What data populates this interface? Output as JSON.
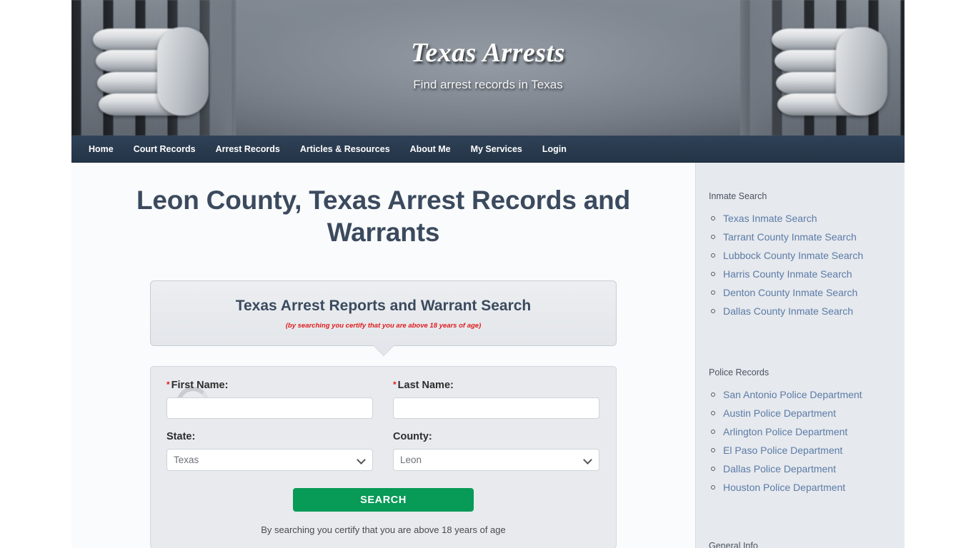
{
  "header": {
    "site_title": "Texas Arrests",
    "tagline": "Find arrest records in Texas"
  },
  "nav": {
    "items": [
      {
        "label": "Home"
      },
      {
        "label": "Court Records"
      },
      {
        "label": "Arrest Records"
      },
      {
        "label": "Articles & Resources"
      },
      {
        "label": "About Me"
      },
      {
        "label": "My Services"
      },
      {
        "label": "Login"
      }
    ]
  },
  "main": {
    "page_title": "Leon County, Texas Arrest Records and Warrants",
    "search_panel": {
      "heading": "Texas Arrest Reports and Warrant Search",
      "age_note": "(by searching you certify that you are above 18 years of age)"
    },
    "form": {
      "first_name": {
        "label": "First Name:",
        "required_mark": "*",
        "value": "",
        "placeholder": ""
      },
      "last_name": {
        "label": "Last Name:",
        "required_mark": "*",
        "value": "",
        "placeholder": ""
      },
      "state": {
        "label": "State:",
        "value": "Texas",
        "options": [
          "Texas"
        ]
      },
      "county": {
        "label": "County:",
        "value": "Leon",
        "options": [
          "Leon"
        ]
      },
      "search_button": "SEARCH",
      "certify_note": "By searching you certify that you are above 18 years of age"
    }
  },
  "sidebar": {
    "widgets": [
      {
        "title": "Inmate Search",
        "links": [
          "Texas Inmate Search",
          "Tarrant County Inmate Search",
          "Lubbock County Inmate Search",
          "Harris County Inmate Search",
          "Denton County Inmate Search",
          "Dallas County Inmate Search"
        ]
      },
      {
        "title": "Police Records",
        "links": [
          "San Antonio Police Department",
          "Austin Police Department",
          "Arlington Police Department",
          "El Paso Police Department",
          "Dallas Police Department",
          "Houston Police Department"
        ]
      },
      {
        "title": "General Info",
        "links": []
      }
    ]
  },
  "colors": {
    "nav_bar": "#2a3b4f",
    "heading_text": "#3b4a5e",
    "search_button": "#089a57",
    "required_red": "#e01b1b",
    "link_blue": "#5b7ba8",
    "sidebar_bg": "#e6e9ed"
  }
}
